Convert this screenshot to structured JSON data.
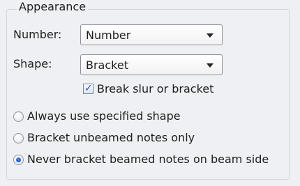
{
  "group": {
    "title": "Appearance"
  },
  "number": {
    "label": "Number:",
    "value": "Number"
  },
  "shape": {
    "label": "Shape:",
    "value": "Bracket"
  },
  "break_slur": {
    "label": "Break slur or bracket",
    "checked": true
  },
  "radios": [
    {
      "label": "Always use specified shape",
      "selected": false
    },
    {
      "label": "Bracket unbeamed notes only",
      "selected": false
    },
    {
      "label": "Never bracket beamed notes on beam side",
      "selected": true
    }
  ],
  "colors": {
    "panel_bg": "#eff0f3",
    "accent": "#1f5cc4",
    "border": "#8a8f99"
  }
}
